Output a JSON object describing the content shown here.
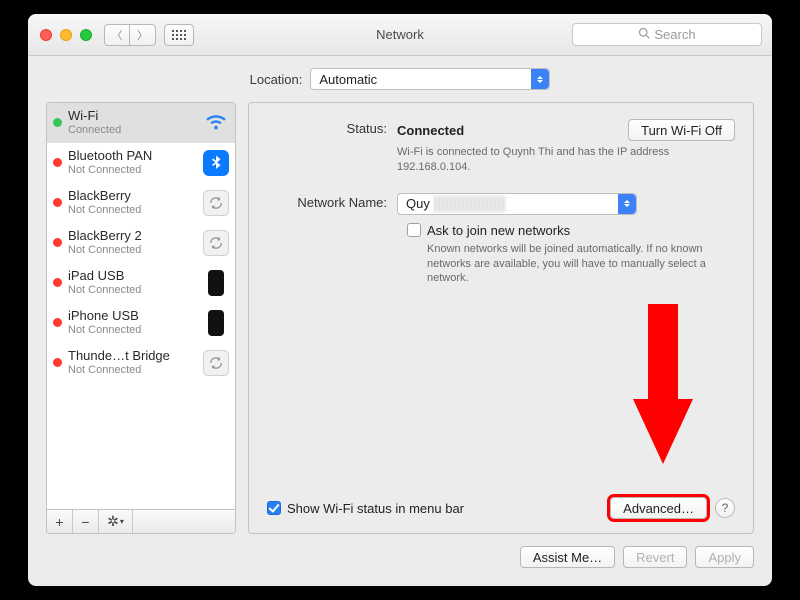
{
  "window": {
    "title": "Network",
    "search_placeholder": "Search"
  },
  "location": {
    "label": "Location:",
    "value": "Automatic"
  },
  "services": [
    {
      "name": "Wi-Fi",
      "sub": "Connected",
      "dot": "green",
      "icon": "wifi",
      "selected": true
    },
    {
      "name": "Bluetooth PAN",
      "sub": "Not Connected",
      "dot": "red",
      "icon": "bluetooth",
      "selected": false
    },
    {
      "name": "BlackBerry",
      "sub": "Not Connected",
      "dot": "red",
      "icon": "disk",
      "selected": false
    },
    {
      "name": "BlackBerry 2",
      "sub": "Not Connected",
      "dot": "red",
      "icon": "disk",
      "selected": false
    },
    {
      "name": "iPad USB",
      "sub": "Not Connected",
      "dot": "red",
      "icon": "phone",
      "selected": false
    },
    {
      "name": "iPhone USB",
      "sub": "Not Connected",
      "dot": "red",
      "icon": "phone",
      "selected": false
    },
    {
      "name": "Thunde…t Bridge",
      "sub": "Not Connected",
      "dot": "red",
      "icon": "disk",
      "selected": false
    }
  ],
  "detail": {
    "status_label": "Status:",
    "status_value": "Connected",
    "toggle_button": "Turn Wi-Fi Off",
    "status_hint": "Wi-Fi is connected to Quynh Thi and has the IP address 192.168.0.104.",
    "network_name_label": "Network Name:",
    "network_name_value": "Quy",
    "ask_join_label": "Ask to join new networks",
    "ask_join_checked": false,
    "ask_join_hint": "Known networks will be joined automatically. If no known networks are available, you will have to manually select a network.",
    "show_menubar_label": "Show Wi-Fi status in menu bar",
    "show_menubar_checked": true,
    "advanced_button": "Advanced…"
  },
  "footer": {
    "assist": "Assist Me…",
    "revert": "Revert",
    "apply": "Apply"
  }
}
